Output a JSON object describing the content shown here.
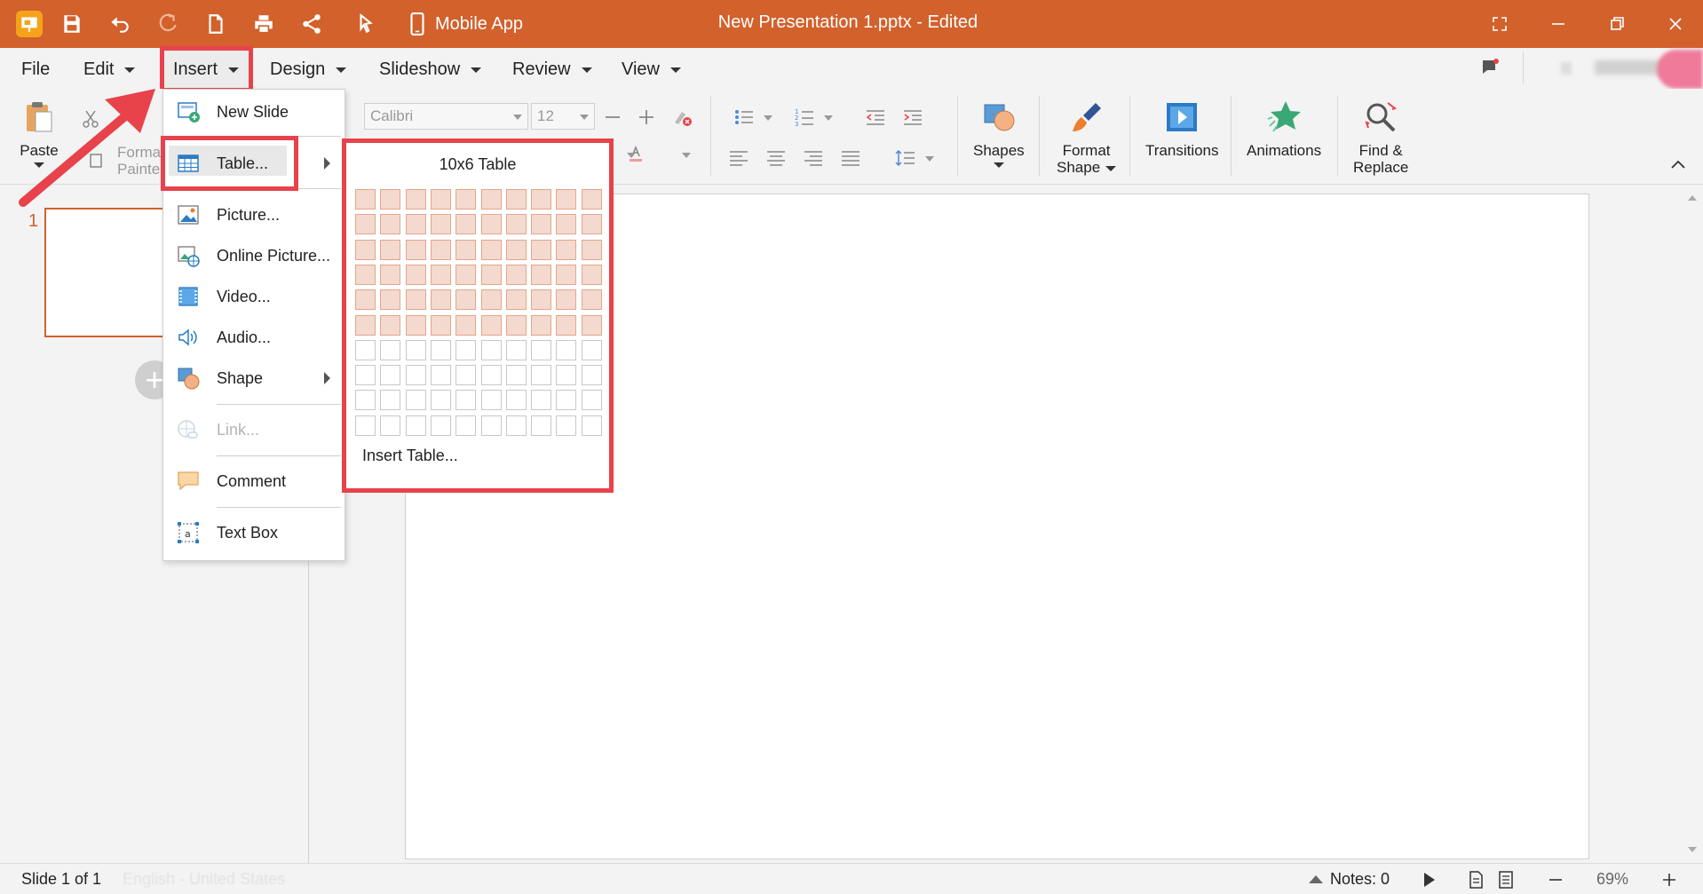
{
  "titlebar": {
    "mobile_app": "Mobile App",
    "title": "New Presentation 1.pptx - Edited"
  },
  "menubar": {
    "items": [
      "File",
      "Edit",
      "Insert",
      "Design",
      "Slideshow",
      "Review",
      "View"
    ]
  },
  "ribbon": {
    "paste": "Paste",
    "format_painter": "Forma\nPainte",
    "font_name": "Calibri",
    "font_size": "12",
    "shapes": "Shapes",
    "format_shape_1": "Format",
    "format_shape_2": "Shape",
    "transitions": "Transitions",
    "animations": "Animations",
    "find_1": "Find &",
    "find_2": "Replace"
  },
  "insert_menu": {
    "new_slide": "New Slide",
    "table": "Table...",
    "picture": "Picture...",
    "online_picture": "Online Picture...",
    "video": "Video...",
    "audio": "Audio...",
    "shape": "Shape",
    "link": "Link...",
    "comment": "Comment",
    "text_box": "Text Box"
  },
  "table_submenu": {
    "title": "10x6 Table",
    "insert_table": "Insert Table...",
    "columns": 10,
    "rows": 10,
    "selected_columns": 10,
    "selected_rows": 6
  },
  "slides": {
    "number": "1"
  },
  "statusbar": {
    "slide_info": "Slide 1 of 1",
    "language": "English - United States",
    "notes": "Notes: 0",
    "zoom": "69%"
  },
  "colors": {
    "accent": "#d2612c",
    "highlight": "#e8424b",
    "cell_selected": "#f4d9cf"
  }
}
